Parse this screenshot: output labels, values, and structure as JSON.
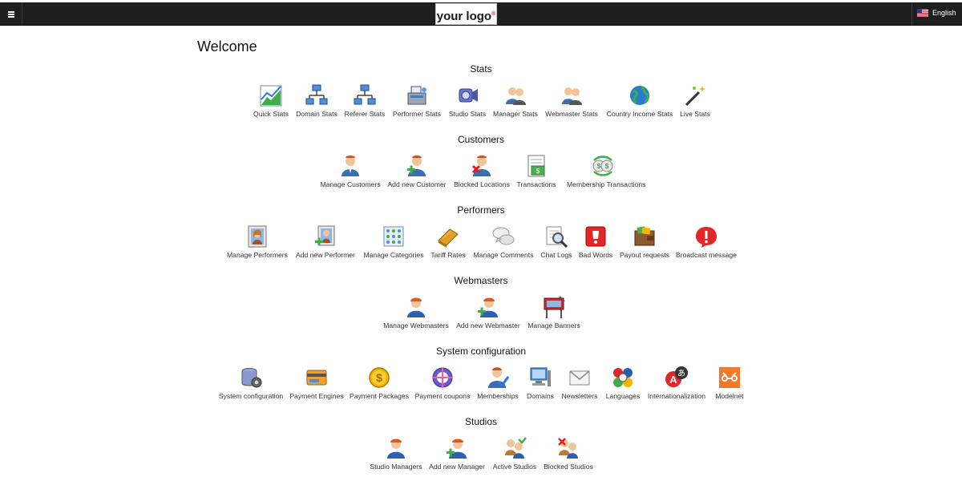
{
  "header": {
    "logo_text": "your logo",
    "logo_mark": "®",
    "language": "English",
    "menu_icon": "hamburger-icon"
  },
  "page_title": "Welcome",
  "sections": [
    {
      "title": "Stats",
      "items": [
        {
          "label": "Quick Stats",
          "icon": "chart-icon"
        },
        {
          "label": "Domain Stats",
          "icon": "network-icon"
        },
        {
          "label": "Referer Stats",
          "icon": "network-icon"
        },
        {
          "label": "Performer Stats",
          "icon": "cash-register-icon"
        },
        {
          "label": "Studio Stats",
          "icon": "camera-icon"
        },
        {
          "label": "Manager Stats",
          "icon": "users-icon"
        },
        {
          "label": "Webmaster Stats",
          "icon": "users-icon"
        },
        {
          "label": "Country Income Stats",
          "icon": "globe-icon"
        },
        {
          "label": "Live Stats",
          "icon": "magic-wand-icon"
        }
      ]
    },
    {
      "title": "Customers",
      "items": [
        {
          "label": "Manage Customers",
          "icon": "user-icon"
        },
        {
          "label": "Add new Customer",
          "icon": "user-add-icon"
        },
        {
          "label": "Blocked Locations",
          "icon": "user-block-icon"
        },
        {
          "label": "Transactions",
          "icon": "ledger-icon"
        },
        {
          "label": "Membership Transactions",
          "icon": "money-exchange-icon"
        }
      ]
    },
    {
      "title": "Performers",
      "items": [
        {
          "label": "Manage Performers",
          "icon": "portrait-icon"
        },
        {
          "label": "Add new Performer",
          "icon": "portrait-add-icon"
        },
        {
          "label": "Manage Categories",
          "icon": "categories-icon"
        },
        {
          "label": "Tariff Rates",
          "icon": "tariff-icon"
        },
        {
          "label": "Manage Comments",
          "icon": "comments-icon"
        },
        {
          "label": "Chat Logs",
          "icon": "magnifier-icon"
        },
        {
          "label": "Bad Words",
          "icon": "bad-words-icon"
        },
        {
          "label": "Payout requests",
          "icon": "wallet-icon"
        },
        {
          "label": "Broadcast message",
          "icon": "alert-icon"
        }
      ]
    },
    {
      "title": "Webmasters",
      "items": [
        {
          "label": "Manage Webmasters",
          "icon": "webmaster-icon"
        },
        {
          "label": "Add new Webmaster",
          "icon": "webmaster-add-icon"
        },
        {
          "label": "Manage Banners",
          "icon": "banner-icon"
        }
      ]
    },
    {
      "title": "System configuration",
      "items": [
        {
          "label": "System configuration",
          "icon": "database-gear-icon"
        },
        {
          "label": "Payment Engines",
          "icon": "credit-card-icon"
        },
        {
          "label": "Payment Packages",
          "icon": "coin-icon"
        },
        {
          "label": "Payment coupons",
          "icon": "coupon-icon"
        },
        {
          "label": "Memberships",
          "icon": "membership-icon"
        },
        {
          "label": "Domains",
          "icon": "computer-icon"
        },
        {
          "label": "Newsletters",
          "icon": "envelope-icon"
        },
        {
          "label": "Languages",
          "icon": "flags-icon"
        },
        {
          "label": "Internationalization",
          "icon": "translate-icon"
        },
        {
          "label": "Modelnet",
          "icon": "modelnet-icon"
        }
      ]
    },
    {
      "title": "Studios",
      "items": [
        {
          "label": "Studio Managers",
          "icon": "manager-icon"
        },
        {
          "label": "Add new Manager",
          "icon": "manager-add-icon"
        },
        {
          "label": "Active Studios",
          "icon": "studio-active-icon"
        },
        {
          "label": "Blocked Studios",
          "icon": "studio-blocked-icon"
        }
      ]
    }
  ]
}
